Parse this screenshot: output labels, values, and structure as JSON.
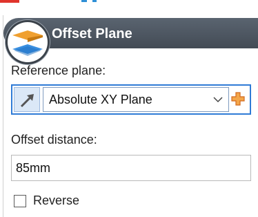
{
  "panel": {
    "title": "Offset Plane",
    "header_icon": "stacked-planes-icon"
  },
  "reference": {
    "label": "Reference plane:",
    "selector_icon": "arrow-select-icon",
    "value": "Absolute XY Plane",
    "dropdown_icon": "chevron-down-icon",
    "add_icon": "plus-icon"
  },
  "offset": {
    "label": "Offset distance:",
    "value": "85mm"
  },
  "reverse": {
    "label": "Reverse",
    "checked": false
  },
  "colors": {
    "title_bg": "#4b535d",
    "focus_border": "#2f7bd6",
    "plus_color": "#e88a1a",
    "plane_top": "#f0a030",
    "plane_bottom": "#3a8fe0"
  }
}
